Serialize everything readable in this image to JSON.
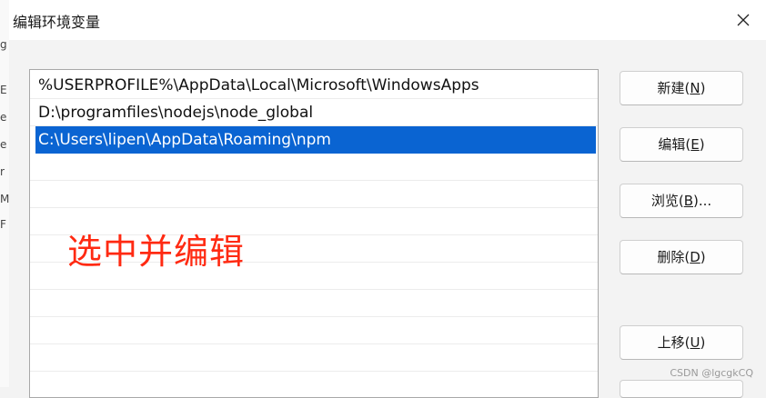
{
  "dialog": {
    "title": "编辑环境变量",
    "close_icon": "close-icon"
  },
  "background_window": {
    "edge_glyphs": [
      "g",
      "E",
      "e",
      "e",
      "r",
      "M",
      "F"
    ]
  },
  "path_list": {
    "items": [
      {
        "text": "%USERPROFILE%\\AppData\\Local\\Microsoft\\WindowsApps",
        "selected": false
      },
      {
        "text": "D:\\programfiles\\nodejs\\node_global",
        "selected": false
      },
      {
        "text": "C:\\Users\\lipen\\AppData\\Roaming\\npm",
        "selected": true
      }
    ],
    "selection_color": "#0a64d2"
  },
  "annotation": {
    "text": "选中并编辑",
    "color": "#ff2a12"
  },
  "buttons": {
    "new": {
      "label": "新建(",
      "key": "N",
      "suffix": ")"
    },
    "edit": {
      "label": "编辑(",
      "key": "E",
      "suffix": ")"
    },
    "browse": {
      "label": "浏览(",
      "key": "B",
      "suffix": ")..."
    },
    "delete": {
      "label": "删除(",
      "key": "D",
      "suffix": ")"
    },
    "move_up": {
      "label": "上移(",
      "key": "U",
      "suffix": ")"
    }
  },
  "watermark": "CSDN @lgcgkCQ"
}
